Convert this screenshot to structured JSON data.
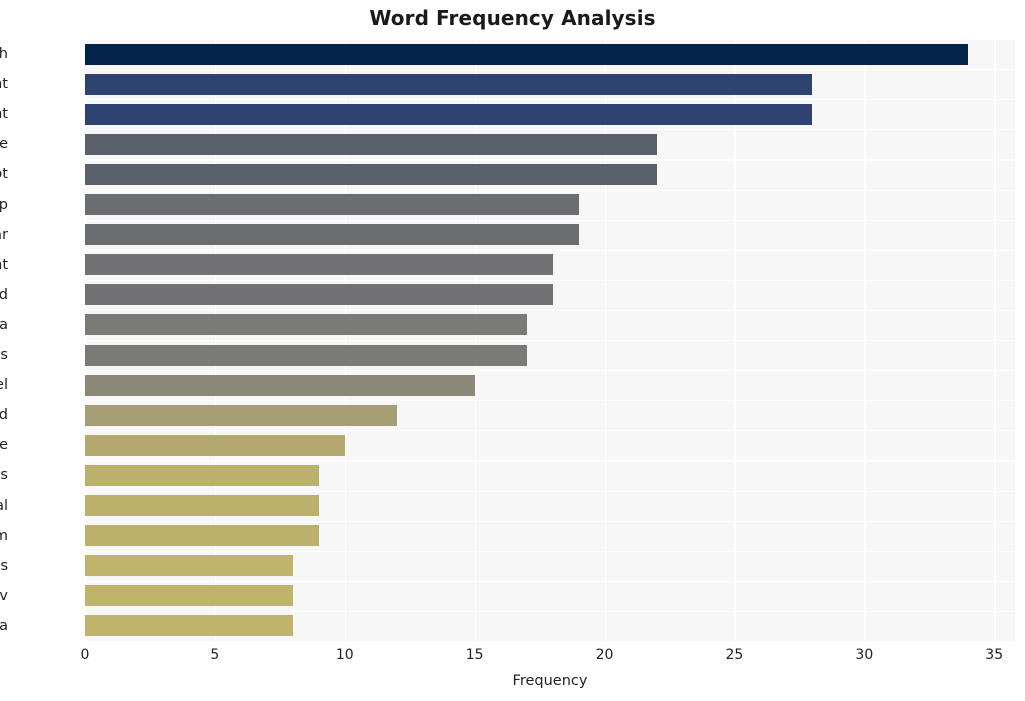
{
  "chart_data": {
    "type": "bar",
    "orientation": "horizontal",
    "title": "Word Frequency Analysis",
    "xlabel": "Frequency",
    "ylabel": "",
    "categories": [
      "growth",
      "plant",
      "point",
      "software",
      "plot",
      "crop",
      "lidar",
      "height",
      "field",
      "data",
      "analysis",
      "model",
      "cloud",
      "time",
      "process",
      "manual",
      "chm",
      "dynamics",
      "uav",
      "alfa"
    ],
    "values": [
      34,
      28,
      28,
      22,
      22,
      19,
      19,
      18,
      18,
      17,
      17,
      15,
      12,
      10,
      9,
      9,
      9,
      8,
      8,
      8
    ],
    "bar_colors": [
      "#04234a",
      "#2e4372",
      "#2e4372",
      "#5a5f6c",
      "#5a5f6c",
      "#6c6d70",
      "#6c6d70",
      "#727274",
      "#727274",
      "#7a7a77",
      "#7a7a77",
      "#8b8878",
      "#a59e74",
      "#b5aa6e",
      "#bcb06d",
      "#bcb06d",
      "#bcb06d",
      "#c0b36c",
      "#c0b36c",
      "#c0b36c"
    ],
    "xticks": [
      0,
      5,
      10,
      15,
      20,
      25,
      30,
      35
    ],
    "xlim": [
      0,
      35.8
    ],
    "grid": true,
    "legend": null,
    "plot_background": "#f7f7f7",
    "gridline_color": "#ffffff",
    "title_color": "#1a1a1a"
  }
}
